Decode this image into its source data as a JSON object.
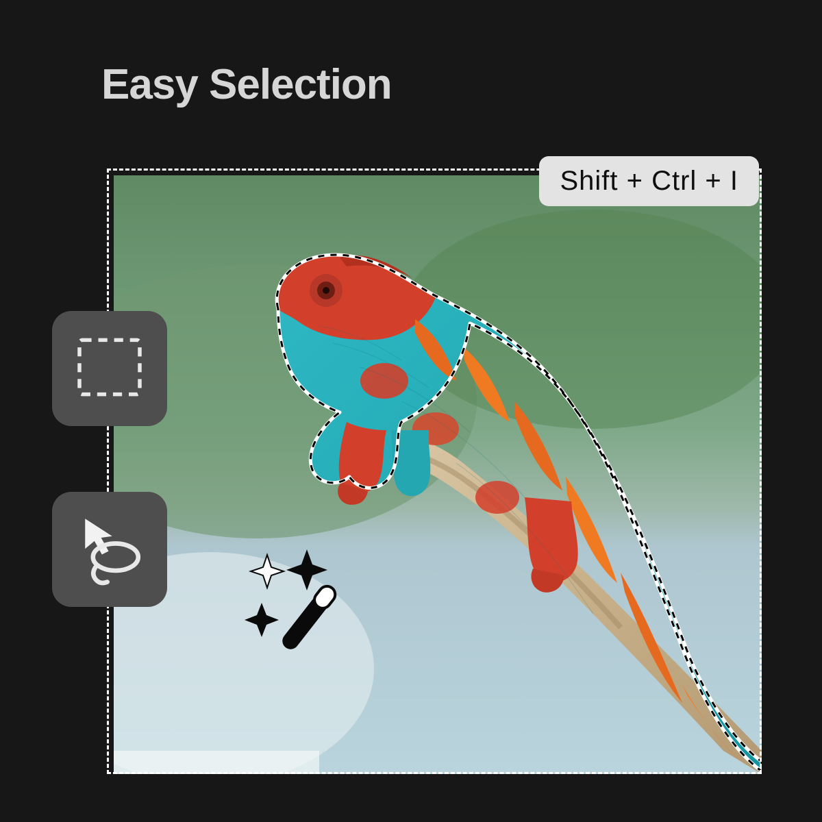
{
  "title": "Easy Selection",
  "shortcut": "Shift + Ctrl + I",
  "tools": {
    "marquee": "marquee-selection",
    "lasso": "lasso-selection"
  },
  "overlay_icon": "magic-wand",
  "subject": "chameleon on branch",
  "colors": {
    "bg": "#171717",
    "tool_bg": "#4e4e4e",
    "badge_bg": "#e3e3e3",
    "title": "#d6d6d6"
  }
}
